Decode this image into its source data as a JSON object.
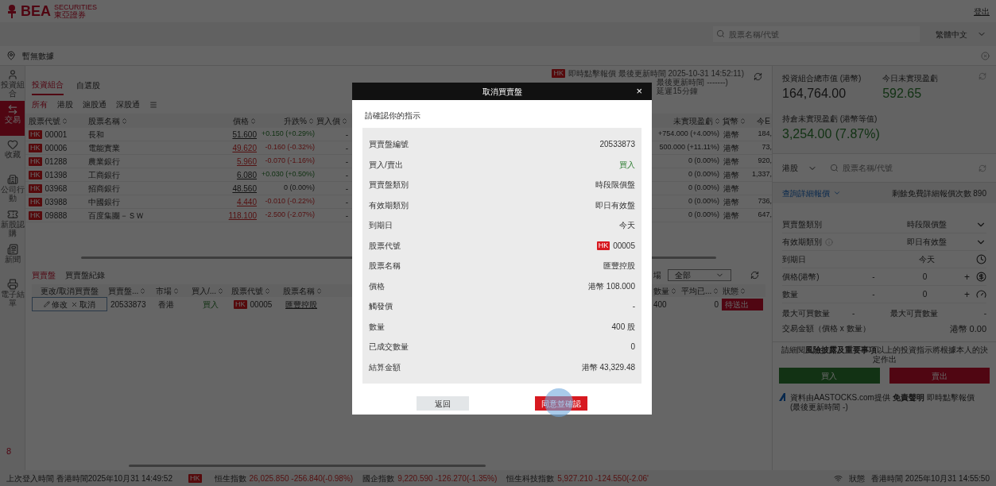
{
  "header": {
    "logo": "BEA",
    "logo_sub_en": "SECURITIES",
    "logo_sub_zh": "東亞證券",
    "logout": "登出"
  },
  "topbar": {
    "search_placeholder": "股票名稱/代號",
    "language": "繁體中文"
  },
  "notice_bar": {
    "text": "暫無數據"
  },
  "nav": [
    {
      "label": "投資組合",
      "selected": false
    },
    {
      "label": "交易",
      "selected": true
    },
    {
      "label": "收藏",
      "selected": false
    },
    {
      "label": "公司行動",
      "selected": false
    },
    {
      "label": "新股認購",
      "selected": false
    },
    {
      "label": "新聞",
      "selected": false
    },
    {
      "label": "電子結單",
      "selected": false
    }
  ],
  "nav_badge": "8",
  "portfolio": {
    "tabs": [
      {
        "label": "投資組合",
        "selected": true
      },
      {
        "label": "自選股",
        "selected": false
      }
    ],
    "quote_badge": "HK",
    "quote_lines": [
      "即時點擊報價 最後更新時間 2025-10-31 14:52:11)",
      "最後更新時間 -------)",
      "延遲15分鐘"
    ],
    "filters": [
      {
        "label": "所有",
        "selected": true
      },
      {
        "label": "港股",
        "selected": false
      },
      {
        "label": "滬股通",
        "selected": false
      },
      {
        "label": "深股通",
        "selected": false
      }
    ],
    "columns": [
      "股票代號",
      "股票名稱",
      "價格",
      "升跌%",
      "買入價",
      "未實現盈虧",
      "貨幣",
      "今E"
    ],
    "rows": [
      {
        "market": "HK",
        "code": "00001",
        "name": "長和",
        "price": "51.600",
        "change": "+0.150 (+0.29%)",
        "kind": "up",
        "bid": "-",
        "unrealized": "+754.000 (+4.00%)",
        "currency": "港幣",
        "today": "184,"
      },
      {
        "market": "HK",
        "code": "00006",
        "name": "電能實業",
        "price": "49.620",
        "change": "-0.160 (-0.32%)",
        "kind": "down",
        "bid": "-",
        "unrealized": "500.000 (+11.11%)",
        "currency": "港幣",
        "today": "73,"
      },
      {
        "market": "HK",
        "code": "01288",
        "name": "農業銀行",
        "price": "5.960",
        "change": "-0.070 (-1.16%)",
        "kind": "down",
        "bid": "-",
        "unrealized": "0 (0.00%)",
        "currency": "港幣",
        "today": "920,"
      },
      {
        "market": "HK",
        "code": "01398",
        "name": "工商銀行",
        "price": "6.080",
        "change": "+0.030 (+0.50%)",
        "kind": "up",
        "bid": "-",
        "unrealized": "0 (0.00%)",
        "currency": "港幣",
        "today": "1,337,"
      },
      {
        "market": "HK",
        "code": "03968",
        "name": "招商銀行",
        "price": "48.560",
        "change": "0 (0.00%)",
        "kind": "flat",
        "bid": "-",
        "unrealized": "0 (0.00%)",
        "currency": "港幣"
      },
      {
        "market": "HK",
        "code": "03988",
        "name": "中國銀行",
        "price": "4.440",
        "change": "-0.010 (-0.22%)",
        "kind": "down",
        "bid": "-",
        "unrealized": "0 (0.00%)",
        "currency": "港幣",
        "today": "736,"
      },
      {
        "market": "HK",
        "code": "09888",
        "name": "百度集團－ＳＷ",
        "price": "118.100",
        "change": "-2.500 (-2.07%)",
        "kind": "down",
        "bid": "-",
        "unrealized": "0 (0.00%)",
        "currency": "港幣",
        "today": "647,"
      }
    ]
  },
  "orders": {
    "tabs": [
      {
        "label": "買賣盤",
        "selected": true
      },
      {
        "label": "買賣盤紀錄",
        "selected": false
      }
    ],
    "market_label": "場",
    "market_select": "全部",
    "columns": [
      "更改/取消買賣盤",
      "買賣盤...",
      "市場",
      "買入/...",
      "股票代號",
      "股票名稱",
      "數量",
      "平均已...",
      "狀態"
    ],
    "rows": [
      {
        "modify": "修改",
        "cancel": "取消",
        "order_no": "20533873",
        "market": "香港",
        "side": "買入",
        "kind": "buy",
        "stock_market": "HK",
        "code": "00005",
        "name": "匯豐控股",
        "quantity": "400",
        "avg": "0",
        "status": "待送出"
      }
    ]
  },
  "summary": {
    "market_value_label": "投資組合總市值 (港幣)",
    "market_value": "164,764.00",
    "today_pl_label": "今日未實現盈虧",
    "today_pl": "592.65",
    "holding_pl_label": "持倉未實現盈虧 (港幣等值)",
    "holding_pl": "3,254.00 (7.87%)"
  },
  "trade": {
    "market": "港股",
    "search_placeholder": "股票名稱/代號",
    "quote_link": "查詢詳細報價",
    "quote_remaining": "剩餘免費詳細報價次數 890",
    "fields": [
      {
        "kind": "select",
        "label": "買賣盤類別",
        "value": "時段限價盤"
      },
      {
        "kind": "select_info",
        "label": "有效期類別",
        "value": "即日有效盤"
      },
      {
        "kind": "date",
        "label": "到期日",
        "value": "今天"
      },
      {
        "kind": "stepper_price",
        "label": "價格(港幣)",
        "minus": "-",
        "value": "0",
        "plus": "+"
      },
      {
        "kind": "stepper_qty",
        "label": "數量",
        "minus": "-",
        "value": "0",
        "plus": "+"
      }
    ],
    "max_buy_label": "最大可買數量",
    "max_buy": "-",
    "max_sell_label": "最大可賣數量",
    "max_sell": "-",
    "amount_label": "交易金額（價格 x 數量）",
    "amount": "港幣 0.00",
    "disclaimer": "請細閱**風險披露及重要事項**以上的投資指示將根據本人的決定作出",
    "buy": "買入",
    "sell": "賣出",
    "source": "資料由AASTOCKS.com提供 **免責聲明** 即時點擊報價",
    "source_time": "(最後更新時間 -)"
  },
  "status_bar": {
    "last_login": "上次登入時間 香港時間2025年10月31 14:49:52",
    "badge": "HK",
    "indices": [
      {
        "name": "恒生指數",
        "value": "26,025.850 -256.840(-0.98%)"
      },
      {
        "name": "國企指數",
        "value": "9,220.590 -126.270(-1.35%)"
      },
      {
        "name": "恒生科技指數",
        "value": "5,927.210 -124.550(-2.06'"
      }
    ],
    "status": "狀態",
    "time": "香港時間 2025年10月31 14:55:50"
  },
  "dialog": {
    "title": "取消買賣盤",
    "close": "×",
    "prompt": "請確認你的指示",
    "rows": [
      {
        "label": "買賣盤編號",
        "value": "20533873"
      },
      {
        "label": "買入/賣出",
        "value": "買入",
        "kind": "buy"
      },
      {
        "label": "買賣盤類別",
        "value": "時段限價盤"
      },
      {
        "label": "有效期類別",
        "value": "即日有效盤"
      },
      {
        "label": "到期日",
        "value": "今天"
      },
      {
        "label": "股票代號",
        "value": "00005",
        "badge": "HK"
      },
      {
        "label": "股票名稱",
        "value": "匯豐控股"
      },
      {
        "label": "價格",
        "value": "港幣 108.000"
      },
      {
        "label": "觸發價",
        "value": "-"
      },
      {
        "label": "數量",
        "value": "400 股"
      },
      {
        "label": "已成交數量",
        "value": "0"
      },
      {
        "label": "結算金額",
        "value": "港幣 43,329.48"
      }
    ],
    "back": "返回",
    "confirm": "同意並確認",
    "pressed": true
  }
}
